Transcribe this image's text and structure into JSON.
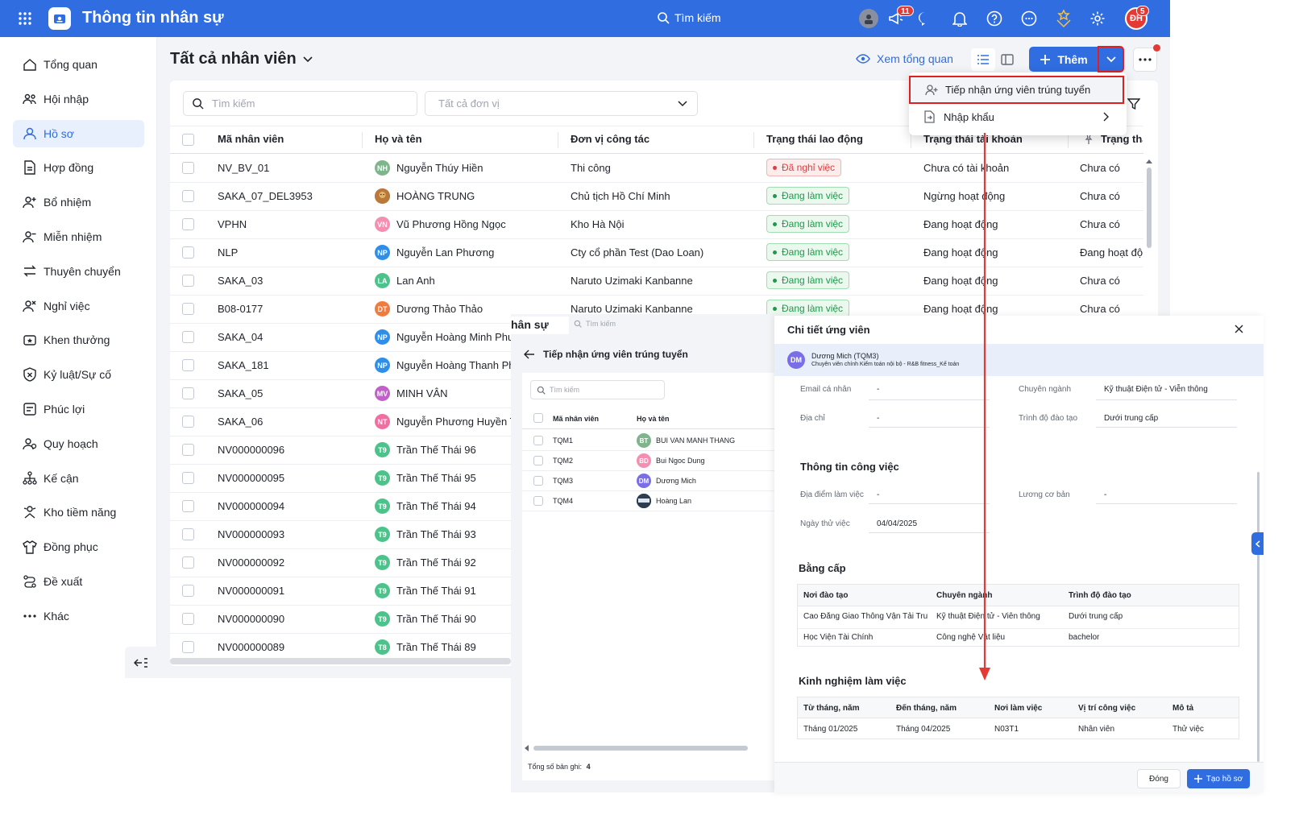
{
  "topbar": {
    "title": "Thông tin nhân sự",
    "search_placeholder": "Tìm kiếm",
    "notif_badge": "11",
    "avatar_initials": "ĐH",
    "avatar_badge": "5"
  },
  "sidebar": {
    "items": [
      {
        "label": "Tổng quan",
        "icon": "home-icon"
      },
      {
        "label": "Hội nhập",
        "icon": "users-icon"
      },
      {
        "label": "Hồ sơ",
        "icon": "user-icon"
      },
      {
        "label": "Hợp đồng",
        "icon": "document-icon"
      },
      {
        "label": "Bổ nhiệm",
        "icon": "user-plus-icon"
      },
      {
        "label": "Miễn nhiệm",
        "icon": "user-minus-icon"
      },
      {
        "label": "Thuyên chuyển",
        "icon": "transfer-icon"
      },
      {
        "label": "Nghỉ việc",
        "icon": "user-x-icon"
      },
      {
        "label": "Khen thưởng",
        "icon": "reward-icon"
      },
      {
        "label": "Kỷ luật/Sự cố",
        "icon": "shield-icon"
      },
      {
        "label": "Phúc lợi",
        "icon": "benefit-icon"
      },
      {
        "label": "Quy hoạch",
        "icon": "plan-icon"
      },
      {
        "label": "Kế cận",
        "icon": "hierarchy-icon"
      },
      {
        "label": "Kho tiềm năng",
        "icon": "talent-icon"
      },
      {
        "label": "Đồng phục",
        "icon": "shirt-icon"
      },
      {
        "label": "Đề xuất",
        "icon": "proposal-icon"
      },
      {
        "label": "Khác",
        "icon": "more-icon"
      }
    ]
  },
  "page": {
    "title": "Tất cả nhân viên",
    "overview_link": "Xem tổng quan",
    "add_button": "Thêm"
  },
  "filters": {
    "search_placeholder": "Tìm kiếm",
    "unit_placeholder": "Tất cả đơn vị"
  },
  "table": {
    "headers": [
      "Mã nhân viên",
      "Họ và tên",
      "Đơn vị công tác",
      "Trạng thái lao động",
      "Trạng thái tài khoản",
      "Trạng thá"
    ],
    "rows": [
      {
        "code": "NV_BV_01",
        "initials": "NH",
        "color": "#7fb58c",
        "name": "Nguyễn Thúy Hiền",
        "unit": "Thi công",
        "status": "Đã nghỉ việc",
        "status_type": "off",
        "account": "Chưa có tài khoản",
        "extra": "Chưa có"
      },
      {
        "code": "SAKA_07_DEL3953",
        "initials": "",
        "color": "#b8793a",
        "name": "HOÀNG TRUNG",
        "unit": "Chủ tịch Hồ Chí Minh",
        "status": "Đang làm việc",
        "status_type": "ok",
        "account": "Ngừng hoạt động",
        "extra": "Chưa có"
      },
      {
        "code": "VPHN",
        "initials": "VN",
        "color": "#f48fb1",
        "name": "Vũ Phương Hồng Ngọc",
        "unit": "Kho Hà Nội",
        "status": "Đang làm việc",
        "status_type": "ok",
        "account": "Đang hoạt động",
        "extra": "Chưa có"
      },
      {
        "code": "NLP",
        "initials": "NP",
        "color": "#2f8fe8",
        "name": "Nguyễn Lan Phương",
        "unit": "Cty cổ phần Test (Dao Loan)",
        "status": "Đang làm việc",
        "status_type": "ok",
        "account": "Đang hoạt động",
        "extra": "Đang hoạt độ"
      },
      {
        "code": "SAKA_03",
        "initials": "LA",
        "color": "#4cc38a",
        "name": "Lan Anh",
        "unit": "Naruto Uzimaki Kanbanne",
        "status": "Đang làm việc",
        "status_type": "ok",
        "account": "Đang hoạt động",
        "extra": "Chưa có"
      },
      {
        "code": "B08-0177",
        "initials": "DT",
        "color": "#f07b3f",
        "name": "Dương Thảo Thảo",
        "unit": "Naruto Uzimaki Kanbanne",
        "status": "Đang làm việc",
        "status_type": "ok",
        "account": "Đang hoạt động",
        "extra": "Chưa có"
      },
      {
        "code": "SAKA_04",
        "initials": "NP",
        "color": "#2f8fe8",
        "name": "Nguyễn Hoàng Minh Phu",
        "unit": "",
        "status": "",
        "status_type": "",
        "account": "",
        "extra": ""
      },
      {
        "code": "SAKA_181",
        "initials": "NP",
        "color": "#2f8fe8",
        "name": "Nguyễn Hoàng Thanh Ph",
        "unit": "",
        "status": "",
        "status_type": "",
        "account": "",
        "extra": ""
      },
      {
        "code": "SAKA_05",
        "initials": "MV",
        "color": "#c060c8",
        "name": "MINH VÂN",
        "unit": "",
        "status": "",
        "status_type": "",
        "account": "",
        "extra": ""
      },
      {
        "code": "SAKA_06",
        "initials": "NT",
        "color": "#f06ea0",
        "name": "Nguyễn Phương Huyền T",
        "unit": "",
        "status": "",
        "status_type": "",
        "account": "",
        "extra": ""
      },
      {
        "code": "NV000000096",
        "initials": "T9",
        "color": "#4cc38a",
        "name": "Trần Thế Thái 96",
        "unit": "",
        "status": "",
        "status_type": "",
        "account": "",
        "extra": ""
      },
      {
        "code": "NV000000095",
        "initials": "T9",
        "color": "#4cc38a",
        "name": "Trần Thế Thái 95",
        "unit": "",
        "status": "",
        "status_type": "",
        "account": "",
        "extra": ""
      },
      {
        "code": "NV000000094",
        "initials": "T9",
        "color": "#4cc38a",
        "name": "Trần Thế Thái 94",
        "unit": "",
        "status": "",
        "status_type": "",
        "account": "",
        "extra": ""
      },
      {
        "code": "NV000000093",
        "initials": "T9",
        "color": "#4cc38a",
        "name": "Trần Thế Thái 93",
        "unit": "",
        "status": "",
        "status_type": "",
        "account": "",
        "extra": ""
      },
      {
        "code": "NV000000092",
        "initials": "T9",
        "color": "#4cc38a",
        "name": "Trần Thế Thái 92",
        "unit": "",
        "status": "",
        "status_type": "",
        "account": "",
        "extra": ""
      },
      {
        "code": "NV000000091",
        "initials": "T9",
        "color": "#4cc38a",
        "name": "Trần Thế Thái 91",
        "unit": "",
        "status": "",
        "status_type": "",
        "account": "",
        "extra": ""
      },
      {
        "code": "NV000000090",
        "initials": "T9",
        "color": "#4cc38a",
        "name": "Trần Thế Thái 90",
        "unit": "",
        "status": "",
        "status_type": "",
        "account": "",
        "extra": ""
      },
      {
        "code": "NV000000089",
        "initials": "T8",
        "color": "#4cc38a",
        "name": "Trần Thế Thái 89",
        "unit": "",
        "status": "",
        "status_type": "",
        "account": "",
        "extra": ""
      }
    ]
  },
  "dropdown": {
    "items": [
      "Tiếp nhận ứng viên trúng tuyển",
      "Nhập khẩu"
    ]
  },
  "mid": {
    "partial_title": "hân sự",
    "search_top": "Tìm kiếm",
    "title": "Tiếp nhận ứng viên trúng tuyển",
    "search_placeholder": "Tìm kiếm",
    "headers": [
      "Mã nhân viên",
      "Họ và tên"
    ],
    "rows": [
      {
        "code": "TQM1",
        "initials": "BT",
        "color": "#7fb58c",
        "name": "BUI VAN MANH THANG"
      },
      {
        "code": "TQM2",
        "initials": "BD",
        "color": "#f48fb1",
        "name": "Bui Ngoc Dung"
      },
      {
        "code": "TQM3",
        "initials": "DM",
        "color": "#7a6ee8",
        "name": "Dương Mich"
      },
      {
        "code": "TQM4",
        "initials": "",
        "color": "#2c3e50",
        "name": "Hoàng Lan"
      }
    ],
    "total_label": "Tổng số bản ghi:",
    "total_value": "4"
  },
  "modal": {
    "title": "Chi tiết ứng viên",
    "candidate": {
      "initials": "DM",
      "name": "Dương Mich (TQM3)",
      "desc": "Chuyên viên chính Kiểm toán nội bộ - R&B fitness_Kế toán"
    },
    "personal": {
      "email_label": "Email cá nhân",
      "email_value": "-",
      "major_label": "Chuyên ngành",
      "major_value": "Kỹ thuật Điện tử - Viễn thông",
      "address_label": "Địa chỉ",
      "address_value": "-",
      "level_label": "Trình độ đào tạo",
      "level_value": "Dưới trung cấp"
    },
    "work": {
      "title": "Thông tin công việc",
      "place_label": "Địa điểm làm việc",
      "place_value": "-",
      "salary_label": "Lương cơ bản",
      "salary_value": "-",
      "trial_label": "Ngày thử việc",
      "trial_value": "04/04/2025"
    },
    "degrees": {
      "title": "Bằng cấp",
      "headers": [
        "Nơi đào tạo",
        "Chuyên ngành",
        "Trình độ đào tạo"
      ],
      "rows": [
        [
          "Cao Đẳng Giao Thông Vận Tải Tru...",
          "Kỹ thuật Điện tử - Viễn thông",
          "Dưới trung cấp"
        ],
        [
          "Học Viện Tài Chính",
          "Công nghệ Vật liệu",
          "bachelor"
        ]
      ]
    },
    "experience": {
      "title": "Kinh nghiệm làm việc",
      "headers": [
        "Từ tháng, năm",
        "Đến tháng, năm",
        "Nơi làm việc",
        "Vị trí công việc",
        "Mô tả"
      ],
      "rows": [
        [
          "Tháng 01/2025",
          "Tháng 04/2025",
          "N03T1",
          "Nhân viên",
          "Thử việc"
        ]
      ]
    },
    "close_button": "Đóng",
    "create_button": "Tạo hồ sơ"
  },
  "colors": {
    "primary": "#2f6de0",
    "highlight_red": "#e02020",
    "ok_green": "#1e9a4b",
    "off_red": "#e03e3e"
  }
}
